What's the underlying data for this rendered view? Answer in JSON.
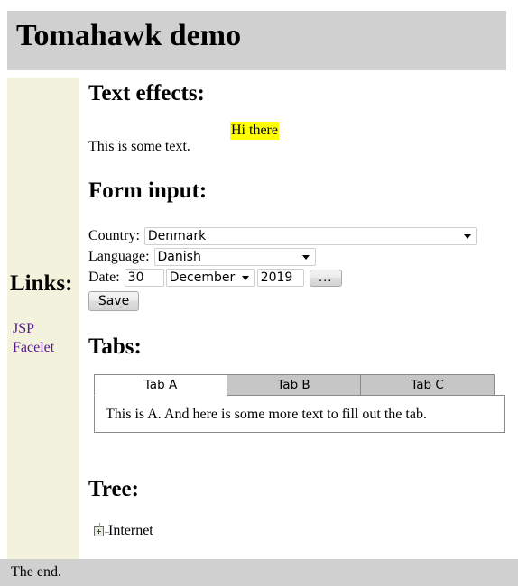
{
  "header": {
    "title": "Tomahawk demo"
  },
  "sidebar": {
    "links_heading": "Links:",
    "links": [
      {
        "label": "JSP"
      },
      {
        "label": "Facelet"
      }
    ]
  },
  "main": {
    "text_effects": {
      "heading": "Text effects:",
      "highlighted_text": "Hi there",
      "highlight_color": "#ffff00",
      "body_text": "This is some text."
    },
    "form": {
      "heading": "Form input:",
      "country": {
        "label": "Country:",
        "value": "Denmark",
        "options": [
          "Denmark"
        ]
      },
      "language": {
        "label": "Language:",
        "value": "Danish",
        "options": [
          "Danish"
        ]
      },
      "date": {
        "label": "Date:",
        "day": "30",
        "month": "December",
        "month_options": [
          "December"
        ],
        "year": "2019",
        "picker_button": "..."
      },
      "save_button": "Save"
    },
    "tabs": {
      "heading": "Tabs:",
      "items": [
        {
          "label": "Tab A",
          "active": true
        },
        {
          "label": "Tab B",
          "active": false
        },
        {
          "label": "Tab C",
          "active": false
        }
      ],
      "panel_text": "This is A. And here is some more text to fill out the tab."
    },
    "tree": {
      "heading": "Tree:",
      "root": {
        "toggle_icon": "expand-plus-icon",
        "label": "Internet"
      }
    }
  },
  "footer": {
    "text": "The end."
  }
}
